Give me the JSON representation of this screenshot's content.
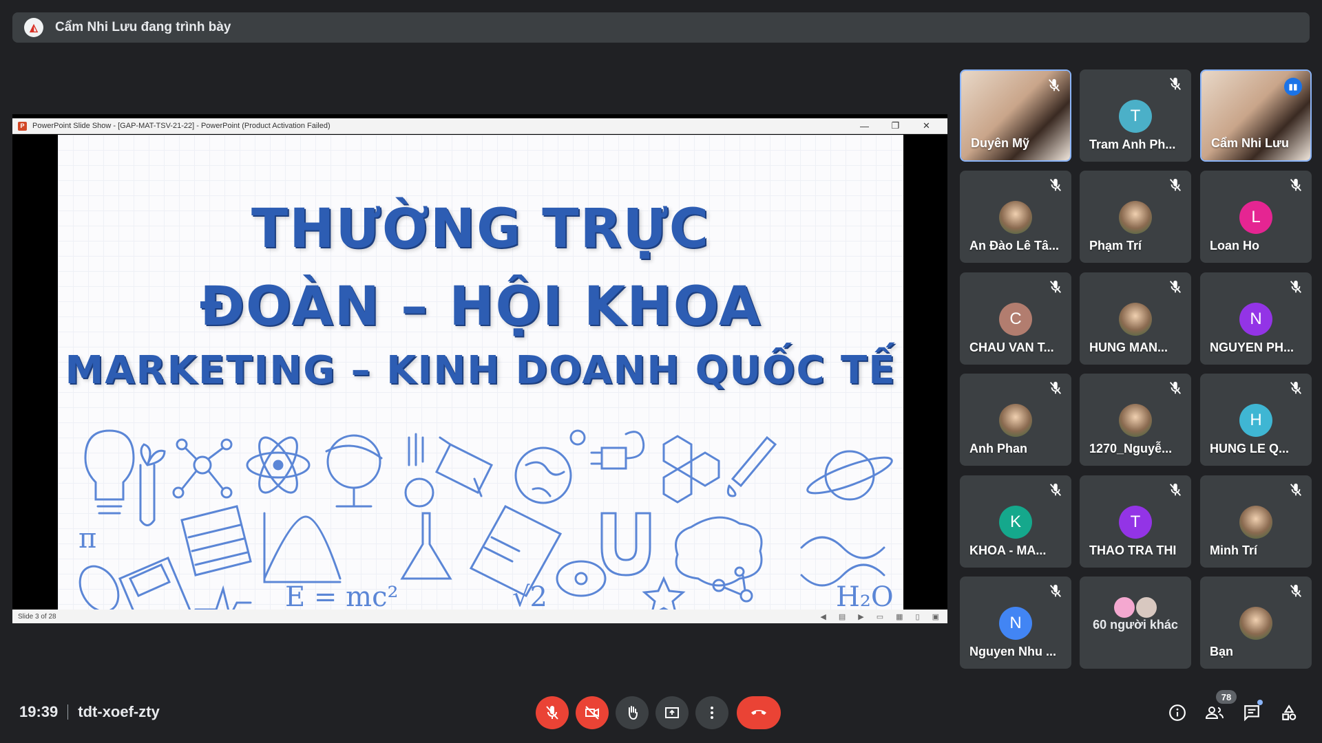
{
  "presenter_bar": {
    "text": "Cẩm Nhi Lưu đang trình bày"
  },
  "powerpoint": {
    "window_title": "PowerPoint Slide Show - [GAP-MAT-TSV-21-22] - PowerPoint (Product Activation Failed)",
    "slide_counter": "Slide 3 of 28",
    "slide": {
      "line1": "THƯỜNG TRỰC",
      "line2": "ĐOÀN – HỘI KHOA",
      "line3": "MARKETING – KINH DOANH QUỐC TẾ",
      "formula": "E = mc²",
      "sqrt": "√2",
      "water": "H₂O",
      "pi": "π"
    }
  },
  "participants": [
    {
      "name": "Duyên Mỹ",
      "type": "video",
      "muted": true
    },
    {
      "name": "Tram Anh Ph...",
      "initial": "T",
      "color": "#4bb0c8",
      "muted": true
    },
    {
      "name": "Cẩm Nhi Lưu",
      "type": "video",
      "speaking": true
    },
    {
      "name": "An Đào Lê Tâ...",
      "type": "photo",
      "muted": true
    },
    {
      "name": "Phạm Trí",
      "type": "photo",
      "muted": true
    },
    {
      "name": "Loan Ho",
      "initial": "L",
      "color": "#e52592",
      "muted": true
    },
    {
      "name": "CHAU VAN T...",
      "initial": "C",
      "color": "#b27d6f",
      "muted": true
    },
    {
      "name": "HUNG MAN...",
      "type": "photo",
      "muted": true
    },
    {
      "name": "NGUYEN PH...",
      "initial": "N",
      "color": "#9334e6",
      "muted": true
    },
    {
      "name": "Anh Phan",
      "type": "photo",
      "muted": true
    },
    {
      "name": "1270_Nguyễ...",
      "type": "photo",
      "muted": true
    },
    {
      "name": "HUNG LE Q...",
      "initial": "H",
      "color": "#3fb6d3",
      "muted": true
    },
    {
      "name": "KHOA - MA...",
      "initial": "K",
      "color": "#15a88c",
      "muted": true
    },
    {
      "name": "THAO TRA THI",
      "initial": "T",
      "color": "#9334e6",
      "muted": true
    },
    {
      "name": "Minh Trí",
      "type": "photo",
      "muted": true
    },
    {
      "name": "Nguyen Nhu ...",
      "initial": "N",
      "color": "#4285f4",
      "muted": true
    },
    {
      "name": "60 người khác",
      "type": "others"
    },
    {
      "name": "Bạn",
      "type": "photo",
      "muted": true
    }
  ],
  "bottom_bar": {
    "time": "19:39",
    "meeting_code": "tdt-xoef-zty",
    "participant_count": "78"
  },
  "colors": {
    "accent_red": "#ea4335",
    "tile_bg": "#3c4043",
    "speaking_blue": "#8ab4f8"
  },
  "icons": [
    "mic-off-icon",
    "camera-off-icon",
    "raise-hand-icon",
    "present-icon",
    "more-options-icon",
    "end-call-icon",
    "info-icon",
    "people-icon",
    "chat-icon",
    "activities-icon"
  ]
}
